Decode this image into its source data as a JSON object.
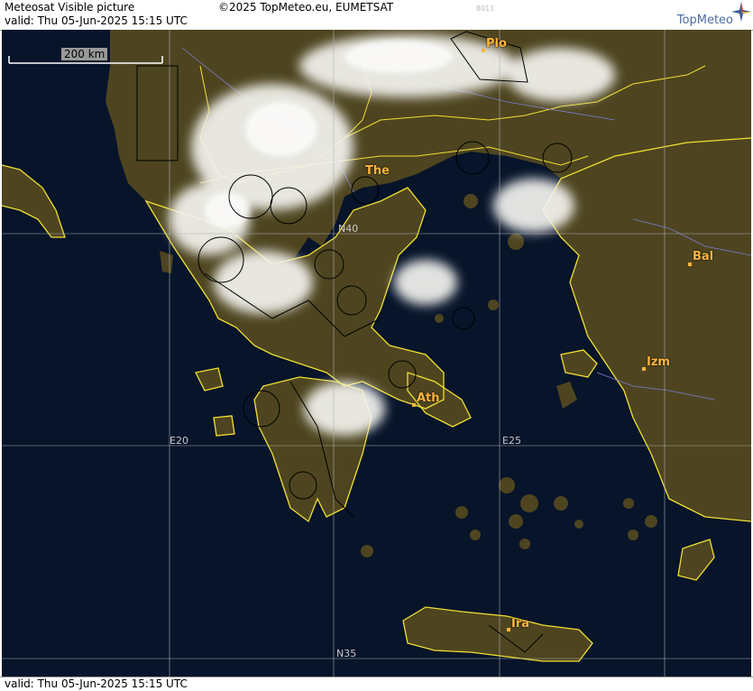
{
  "header": {
    "title": "Meteosat Visible picture",
    "valid": "valid:  Thu  05-Jun-2025  15:15 UTC",
    "copyright": "©2025 TopMeteo.eu, EUMETSAT",
    "code": "8011",
    "brand": "TopMeteo",
    "brand_icon": "compass-star-icon"
  },
  "footer": {
    "valid": "valid:  Thu  05-Jun-2025  15:15 UTC"
  },
  "map": {
    "scale_label": "200 km",
    "grid_labels": {
      "lat40": "N40",
      "lat35": "N35",
      "lon20": "E20",
      "lon25": "E25"
    },
    "cities": {
      "plo": "Plo",
      "the": "The",
      "bal": "Bal",
      "izm": "Izm",
      "ath": "Ath",
      "ira": "Ira"
    },
    "colors": {
      "sea": "#07142a",
      "land": "#4e4520",
      "coast": "#f0e030",
      "grid": "#b0b0b0",
      "city": "#ffb43c"
    }
  }
}
